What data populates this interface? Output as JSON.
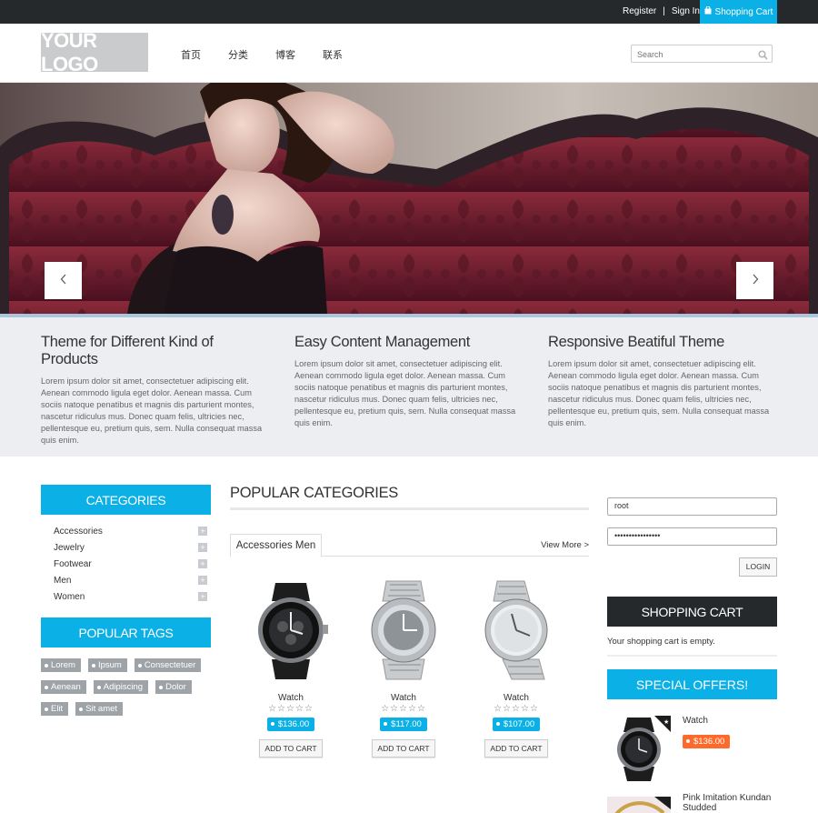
{
  "topbar": {
    "register_label": "Register",
    "separator": "|",
    "signin_label": "Sign In",
    "cart_label": "Shopping Cart",
    "cart_icon": "bag-icon"
  },
  "header": {
    "logo_text": "YOUR LOGO",
    "nav": [
      "首页",
      "分类",
      "博客",
      "联系"
    ],
    "search_placeholder": "Search",
    "search_icon": "search-icon"
  },
  "hero": {
    "prev_icon": "chevron-left-icon",
    "next_icon": "chevron-right-icon"
  },
  "features": [
    {
      "title": "Theme for Different Kind of Products",
      "text": "Lorem ipsum dolor sit amet, consectetuer adipiscing elit. Aenean commodo ligula eget dolor. Aenean massa. Cum sociis natoque penatibus et magnis dis parturient montes, nascetur ridiculus mus. Donec quam felis, ultricies nec, pellentesque eu, pretium quis, sem. Nulla consequat massa quis enim."
    },
    {
      "title": "Easy Content Management",
      "text": "Lorem ipsum dolor sit amet, consectetuer adipiscing elit. Aenean commodo ligula eget dolor. Aenean massa. Cum sociis natoque penatibus et magnis dis parturient montes, nascetur ridiculus mus. Donec quam felis, ultricies nec, pellentesque eu, pretium quis, sem. Nulla consequat massa quis enim."
    },
    {
      "title": "Responsive Beatiful Theme",
      "text": "Lorem ipsum dolor sit amet, consectetuer adipiscing elit. Aenean commodo ligula eget dolor. Aenean massa. Cum sociis natoque penatibus et magnis dis parturient montes, nascetur ridiculus mus. Donec quam felis, ultricies nec, pellentesque eu, pretium quis, sem. Nulla consequat massa quis enim."
    }
  ],
  "sidebar": {
    "categories_title": "CATEGORIES",
    "categories": [
      "Accessories",
      "Jewelry",
      "Footwear",
      "Men",
      "Women"
    ],
    "expand_symbol": "+",
    "tags_title": "POPULAR TAGS",
    "tags": [
      "Lorem",
      "Ipsum",
      "Consectetuer",
      "Aenean",
      "Adipiscing",
      "Dolor",
      "Elit",
      "Sit amet"
    ]
  },
  "popular": {
    "title": "POPULAR CATEGORIES",
    "tab_label": "Accessories Men",
    "view_more": "View More >",
    "products": [
      {
        "name": "Watch",
        "stars": "☆☆☆☆☆",
        "price": "$136.00",
        "button": "ADD TO CART",
        "rating": 0
      },
      {
        "name": "Watch",
        "stars": "☆☆☆☆☆",
        "price": "$117.00",
        "button": "ADD TO CART",
        "rating": 0
      },
      {
        "name": "Watch",
        "stars": "☆☆☆☆☆",
        "price": "$107.00",
        "button": "ADD TO CART",
        "rating": 0
      }
    ]
  },
  "account": {
    "username_value": "root",
    "password_value": "••••••••••••••••",
    "login_label": "LOGIN"
  },
  "cart": {
    "title": "SHOPPING CART",
    "empty_text": "Your shopping cart is empty."
  },
  "special": {
    "title": "SPECIAL OFFERS!",
    "items": [
      {
        "name": "Watch",
        "price": "$136.00"
      },
      {
        "name": "Pink Imitation Kundan Studded",
        "price": ""
      }
    ]
  },
  "colors": {
    "accent": "#0ab0e6",
    "dark": "#26292c",
    "offer": "#ff6a2b"
  }
}
